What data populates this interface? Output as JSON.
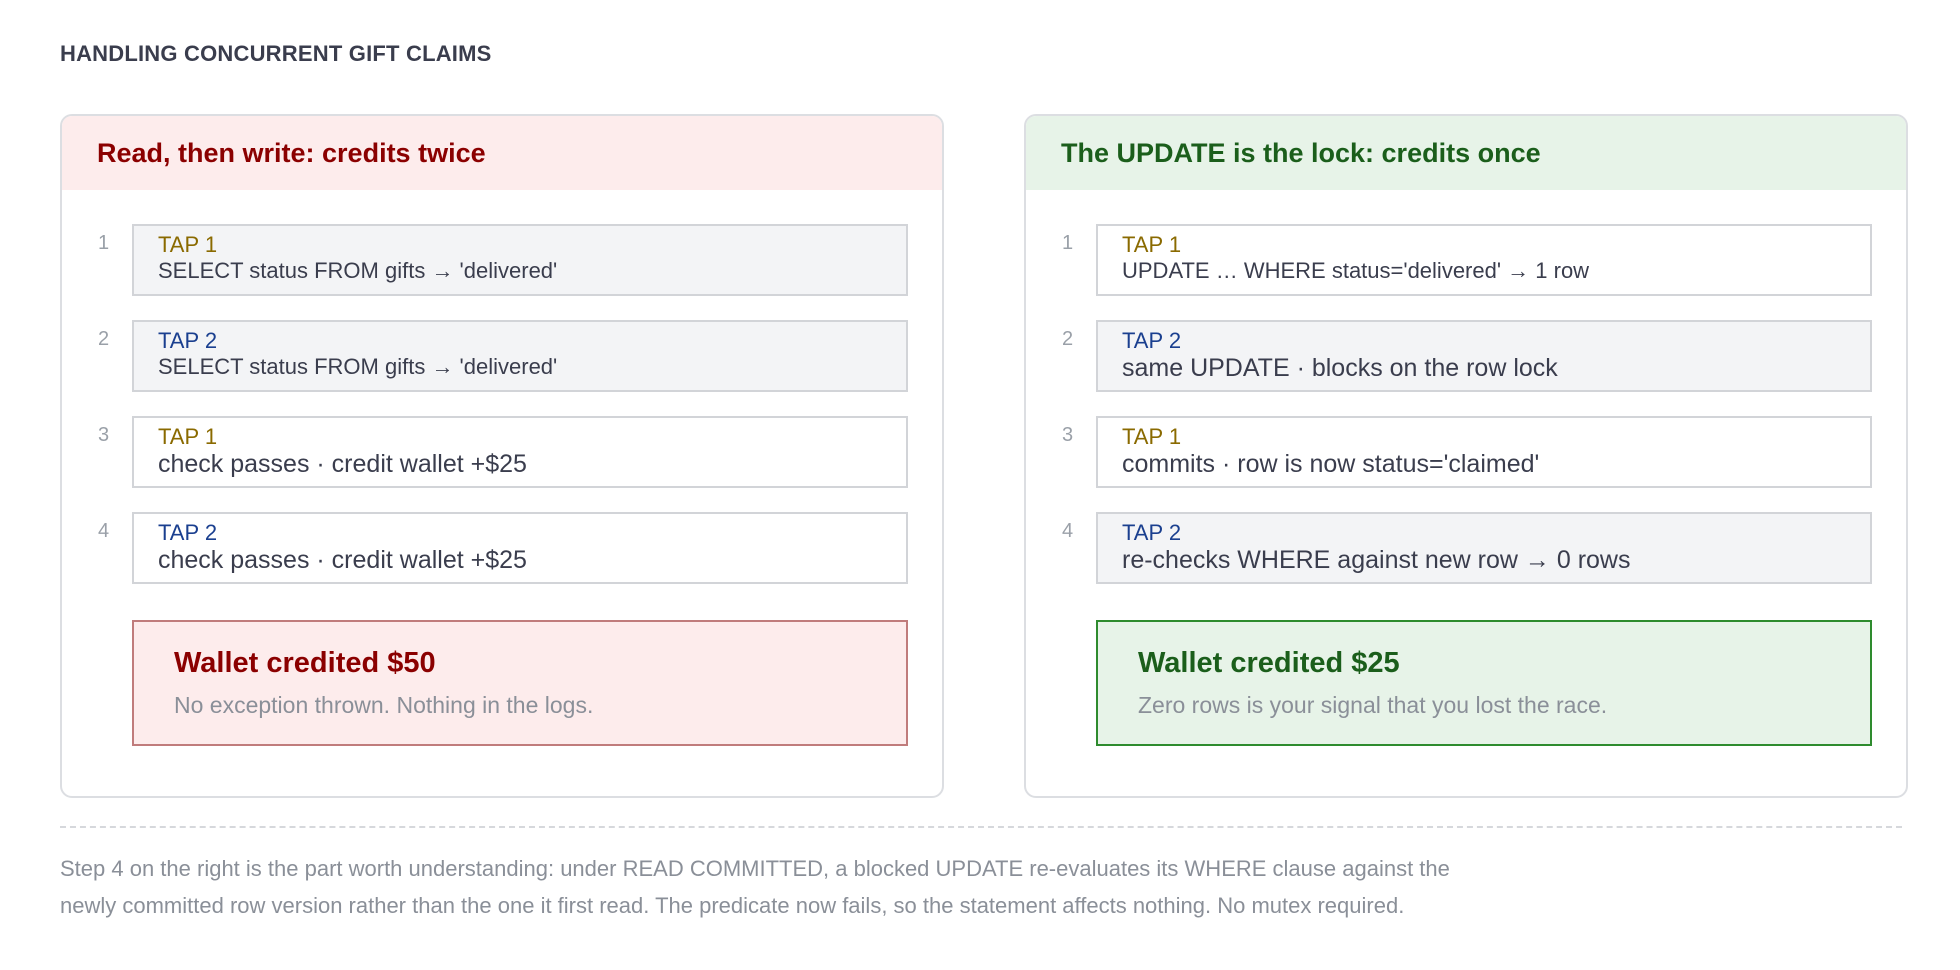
{
  "heading": "HANDLING CONCURRENT GIFT CLAIMS",
  "left": {
    "title": "Read, then write: credits twice",
    "steps": [
      {
        "num": "1",
        "who": "TAP 1",
        "text": "SELECT status FROM gifts → 'delivered'"
      },
      {
        "num": "2",
        "who": "TAP 2",
        "text": "SELECT status FROM gifts → 'delivered'"
      },
      {
        "num": "3",
        "who": "TAP 1",
        "text": "check passes · credit wallet +$25"
      },
      {
        "num": "4",
        "who": "TAP 2",
        "text": "check passes · credit wallet +$25"
      }
    ],
    "result_title": "Wallet credited $50",
    "result_sub": "No exception thrown. Nothing in the logs."
  },
  "right": {
    "title": "The UPDATE is the lock: credits once",
    "steps": [
      {
        "num": "1",
        "who": "TAP 1",
        "text": "UPDATE … WHERE status='delivered' → 1 row"
      },
      {
        "num": "2",
        "who": "TAP 2",
        "text": "same UPDATE · blocks on the row lock"
      },
      {
        "num": "3",
        "who": "TAP 1",
        "text": "commits · row is now status='claimed'"
      },
      {
        "num": "4",
        "who": "TAP 2",
        "text": "re-checks WHERE against new row → 0 rows"
      }
    ],
    "result_title": "Wallet credited $25",
    "result_sub": "Zero rows is your signal that you lost the race."
  },
  "footnote": {
    "line1": "Step 4 on the right is the part worth understanding: under READ COMMITTED, a blocked UPDATE re-evaluates its WHERE clause against the",
    "line2": "newly committed row version rather than the one it first read. The predicate now fails, so the statement affects nothing. No mutex required."
  }
}
